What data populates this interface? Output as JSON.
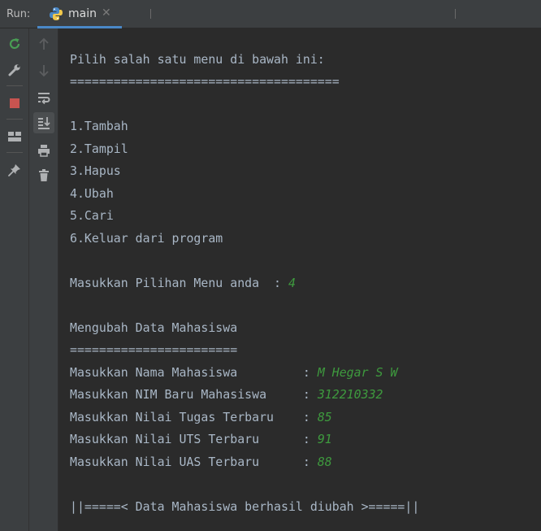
{
  "run_panel": {
    "label": "Run:",
    "tab": {
      "title": "main",
      "icon": "python-icon",
      "close_icon": "close-icon"
    }
  },
  "left_toolbar": [
    {
      "name": "rerun-icon",
      "color": "#499c54"
    },
    {
      "name": "wrench-icon",
      "color": "#afb1b3"
    },
    {
      "name": "stop-icon",
      "color": "#c75450"
    },
    {
      "name": "layout-icon",
      "color": "#afb1b3"
    },
    {
      "name": "pin-icon",
      "color": "#afb1b3"
    }
  ],
  "second_toolbar": [
    {
      "name": "up-arrow-icon"
    },
    {
      "name": "down-arrow-icon"
    },
    {
      "name": "soft-wrap-icon"
    },
    {
      "name": "scroll-to-end-icon",
      "active": true
    },
    {
      "name": "print-icon"
    },
    {
      "name": "trash-icon"
    }
  ],
  "console": {
    "text_color": "#a9b7c6",
    "input_color": "#3e9a3e",
    "menu_title": "Pilih salah satu menu di bawah ini:",
    "menu_rule": "=====================================",
    "menu_items": [
      "1.Tambah",
      "2.Tampil",
      "3.Hapus",
      "4.Ubah",
      "5.Cari",
      "6.Keluar dari program"
    ],
    "choice_prompt": "Masukkan Pilihan Menu anda  : ",
    "choice_value": "4",
    "section_title": "Mengubah Data Mahasiswa",
    "section_rule": "=======================",
    "fields": [
      {
        "prompt": "Masukkan Nama Mahasiswa         : ",
        "value": "M Hegar S W"
      },
      {
        "prompt": "Masukkan NIM Baru Mahasiswa     : ",
        "value": "312210332"
      },
      {
        "prompt": "Masukkan Nilai Tugas Terbaru    : ",
        "value": "85"
      },
      {
        "prompt": "Masukkan Nilai UTS Terbaru      : ",
        "value": "91"
      },
      {
        "prompt": "Masukkan Nilai UAS Terbaru      : ",
        "value": "88"
      }
    ],
    "success_message": "||=====< Data Mahasiswa berhasil diubah >=====||"
  }
}
